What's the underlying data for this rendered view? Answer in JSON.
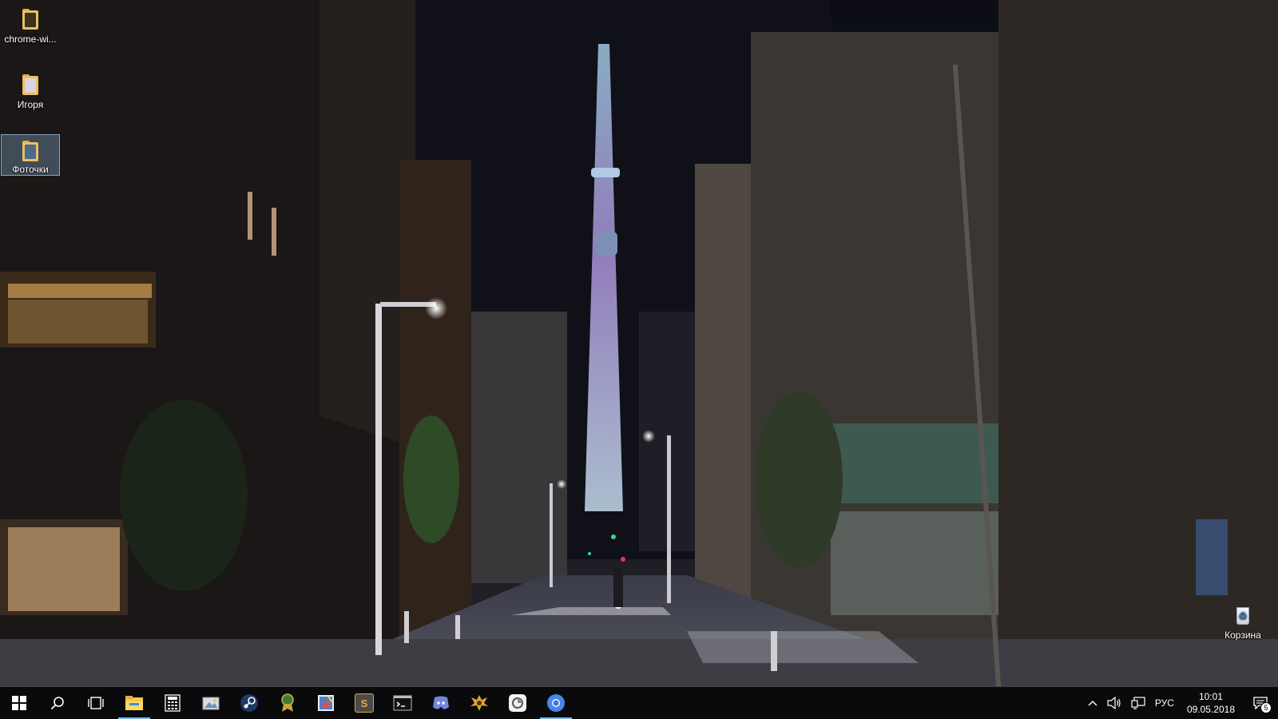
{
  "desktop": {
    "icons": [
      {
        "label": "chrome-wi...",
        "icon": "folder-icon"
      },
      {
        "label": "Игоря",
        "icon": "folder-icon"
      },
      {
        "label": "Фоточки",
        "icon": "folder-icon",
        "selected": true
      },
      {
        "label": "Корзина",
        "icon": "recycle-bin-icon"
      }
    ],
    "wallpaper": "night-city-street-tower"
  },
  "taskbar": {
    "pinned": [
      {
        "name": "start-button",
        "icon": "windows-logo-icon"
      },
      {
        "name": "search-button",
        "icon": "search-icon"
      },
      {
        "name": "task-view-button",
        "icon": "task-view-icon"
      },
      {
        "name": "taskbar-file-explorer",
        "icon": "file-explorer-icon",
        "active": true
      },
      {
        "name": "taskbar-calculator",
        "icon": "calculator-icon"
      },
      {
        "name": "taskbar-photos",
        "icon": "photos-icon"
      },
      {
        "name": "taskbar-steam",
        "icon": "steam-icon"
      },
      {
        "name": "taskbar-award-app",
        "icon": "ribbon-icon"
      },
      {
        "name": "taskbar-paint",
        "icon": "paint-icon"
      },
      {
        "name": "taskbar-sublime",
        "icon": "sublime-icon",
        "glyph": "S"
      },
      {
        "name": "taskbar-terminal",
        "icon": "terminal-icon"
      },
      {
        "name": "taskbar-discord",
        "icon": "discord-icon"
      },
      {
        "name": "taskbar-game-launcher",
        "icon": "crest-icon"
      },
      {
        "name": "taskbar-app-circle",
        "icon": "app-icon"
      },
      {
        "name": "taskbar-chrome",
        "icon": "chrome-icon",
        "active": true
      }
    ],
    "tray": {
      "language": "РУС",
      "time": "10:01",
      "date": "09.05.2018",
      "notification_count": "5"
    }
  },
  "colors": {
    "taskbar_bg": "#0a0a0c",
    "active_indicator": "#76b9ed",
    "selection": "#8cafd7"
  }
}
